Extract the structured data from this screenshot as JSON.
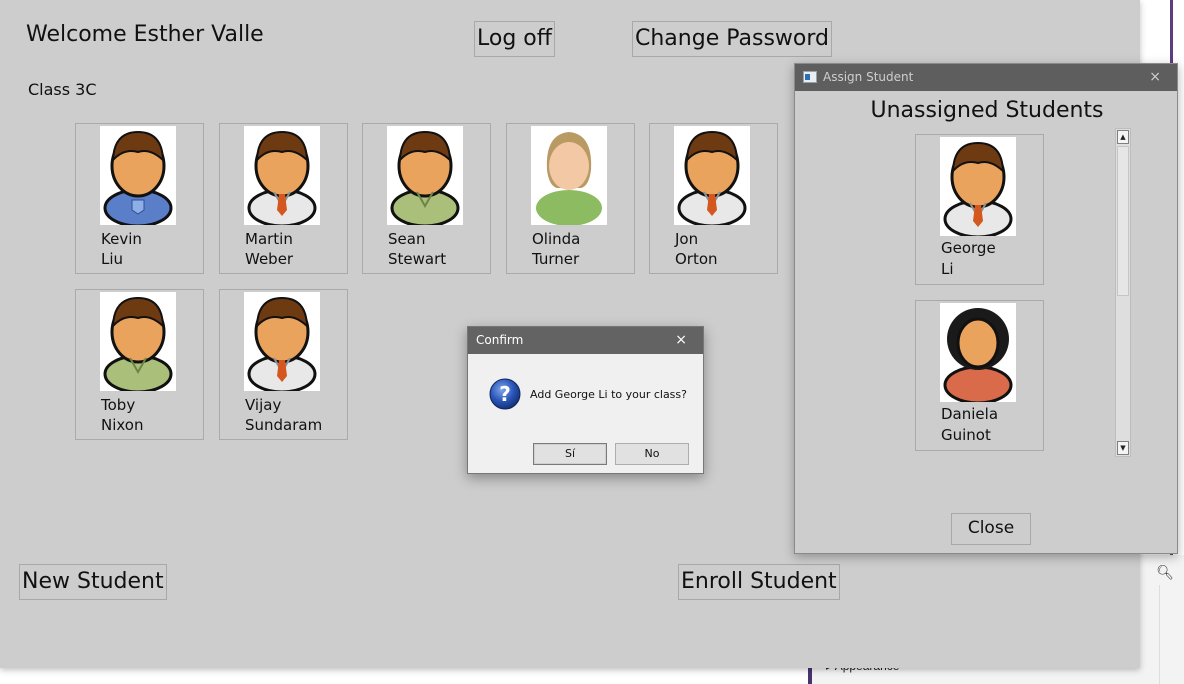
{
  "main": {
    "welcome": "Welcome Esther Valle",
    "log_off": "Log off",
    "change_password": "Change Password",
    "class_name": "Class 3C",
    "students": [
      {
        "first": "Kevin",
        "last": "Liu",
        "avatar": "boy-blue-shirt"
      },
      {
        "first": "Martin",
        "last": "Weber",
        "avatar": "boy-white-shirt-tie"
      },
      {
        "first": "Sean",
        "last": "Stewart",
        "avatar": "boy-green-shirt"
      },
      {
        "first": "Olinda",
        "last": "Turner",
        "avatar": "girl-green-shirt"
      },
      {
        "first": "Jon",
        "last": "Orton",
        "avatar": "boy-white-shirt-tie"
      },
      {
        "first": "Toby",
        "last": "Nixon",
        "avatar": "boy-green-shirt"
      },
      {
        "first": "Vijay",
        "last": "Sundaram",
        "avatar": "boy-white-shirt-tie"
      }
    ],
    "new_student": "New Student",
    "enroll_student": "Enroll Student"
  },
  "confirm": {
    "title": "Confirm",
    "close_glyph": "×",
    "message": "Add George Li to your class?",
    "yes": "Sí",
    "no": "No",
    "icon": "question-icon"
  },
  "assign": {
    "title": "Assign Student",
    "close_glyph": "×",
    "heading": "Unassigned Students",
    "students": [
      {
        "first": "George",
        "last": "Li",
        "avatar": "boy-white-shirt-tie"
      },
      {
        "first": "Daniela",
        "last": "Guinot",
        "avatar": "girl-red-shirt"
      }
    ],
    "close": "Close"
  },
  "background": {
    "appearance": "Appearance",
    "search_icon": "magnifier-icon"
  },
  "colors": {
    "window_bg": "#cdcdcd",
    "titlebar": "#636363",
    "dialog_bg": "#f0f0f0"
  }
}
